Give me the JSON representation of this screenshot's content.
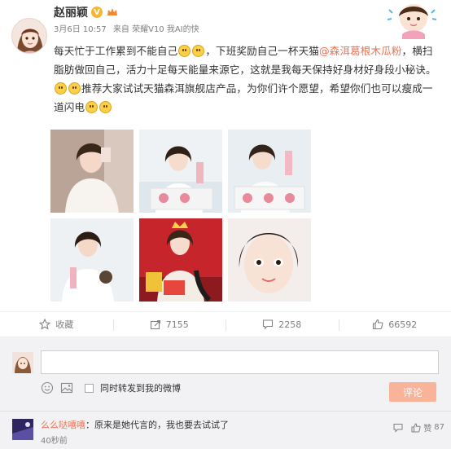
{
  "post": {
    "username": "赵丽颖",
    "verified_badge": "V",
    "date": "3月6日 10:57",
    "source": "来自 荣耀V10 我AI的快",
    "text_1": "每天忙于工作累到不能自己",
    "text_2": "，下班奖励自己一杯天猫",
    "mention": "@森洱葛根木瓜粉",
    "text_3": "，横扫脂肪做回自己，活力十足每天能量来源它，这就是我每天保持好身材好身段小秘诀。",
    "text_4": "推荐大家试试天猫森洱旗舰店产品，为你们许个愿望，希望你们也可以瘦成一道闪电",
    "photo_count": 6
  },
  "actions": {
    "favorite_label": "收藏",
    "share_count": "7155",
    "comment_count": "2258",
    "like_count": "66592"
  },
  "composer": {
    "input_value": "",
    "repost_label": "同时转发到我的微博",
    "submit_label": "评论"
  },
  "comment": {
    "user": "么么哒嘻嘻",
    "separator": "：",
    "text": "原来是她代言的，我也要去试试了",
    "time": "40秒前",
    "like_label": "赞",
    "like_count": "87"
  },
  "colors": {
    "accent": "#eb7350",
    "submit_bg": "#f8b398",
    "verified": "#f8b433",
    "composer_bg": "#f2f2f5"
  }
}
